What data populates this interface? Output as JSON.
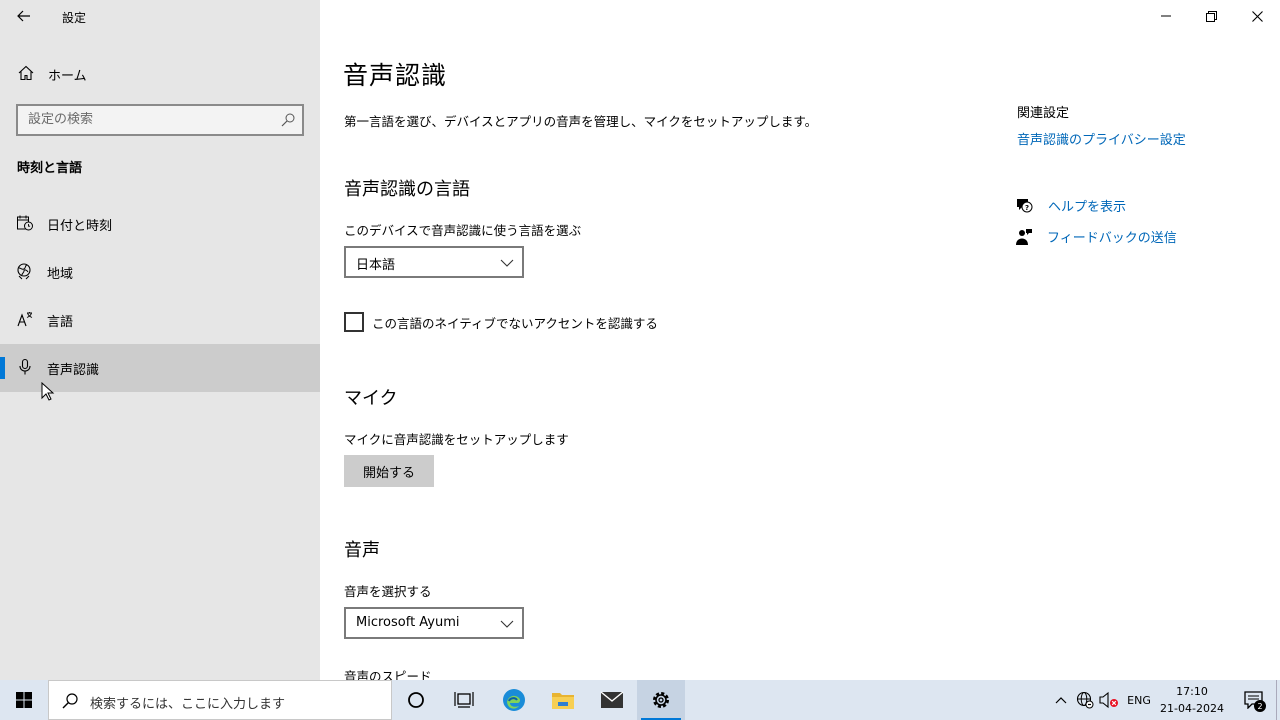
{
  "window": {
    "app_title": "設定"
  },
  "sidebar": {
    "home_label": "ホーム",
    "search_placeholder": "設定の検索",
    "section_title": "時刻と言語",
    "items": [
      {
        "label": "日付と時刻",
        "icon": "date-time-icon"
      },
      {
        "label": "地域",
        "icon": "region-icon"
      },
      {
        "label": "言語",
        "icon": "language-icon"
      },
      {
        "label": "音声認識",
        "icon": "microphone-icon",
        "selected": true
      }
    ]
  },
  "main": {
    "title": "音声認識",
    "description": "第一言語を選び、デバイスとアプリの音声を管理し、マイクをセットアップします。",
    "speech_language": {
      "heading": "音声認識の言語",
      "label": "このデバイスで音声認識に使う言語を選ぶ",
      "selected_value": "日本語",
      "checkbox_label": "この言語のネイティブでないアクセントを認識する",
      "checkbox_checked": false
    },
    "microphone": {
      "heading": "マイク",
      "label": "マイクに音声認識をセットアップします",
      "button_label": "開始する"
    },
    "voice": {
      "heading": "音声",
      "label": "音声を選択する",
      "selected_value": "Microsoft Ayumi",
      "speed_label": "音声のスピード"
    }
  },
  "related": {
    "heading": "関連設定",
    "privacy_link": "音声認識のプライバシー設定",
    "help_link": "ヘルプを表示",
    "feedback_link": "フィードバックの送信"
  },
  "taskbar": {
    "search_placeholder": "検索するには、ここに入力します",
    "language_indicator": "ENG",
    "time": "17:10",
    "date": "21-04-2024",
    "notification_count": "2"
  },
  "colors": {
    "accent": "#0078d7",
    "link": "#0067b8",
    "sidebar_bg": "#e6e6e6",
    "taskbar_bg": "#dde6f1"
  }
}
